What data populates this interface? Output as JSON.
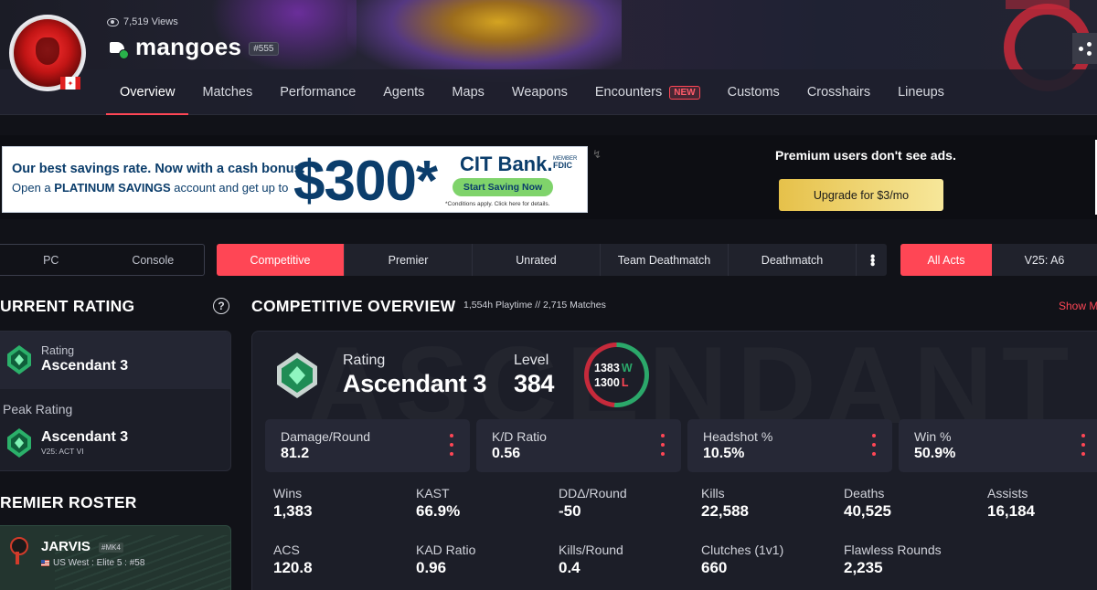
{
  "profile": {
    "views": "7,519 Views",
    "name": "mangoes",
    "tag": "#555"
  },
  "nav": {
    "tabs": [
      {
        "label": "Overview"
      },
      {
        "label": "Matches"
      },
      {
        "label": "Performance"
      },
      {
        "label": "Agents"
      },
      {
        "label": "Maps"
      },
      {
        "label": "Weapons"
      },
      {
        "label": "Encounters",
        "badge": "NEW"
      },
      {
        "label": "Customs"
      },
      {
        "label": "Crosshairs"
      },
      {
        "label": "Lineups"
      }
    ]
  },
  "ad": {
    "line1": "Our best savings rate. Now with a cash bonus.",
    "line2_pre": "Open a",
    "line2_bold": "PLATINUM SAVINGS",
    "line2_post": "account and get up to",
    "amount": "$300*",
    "brand": "CIT Bank.",
    "member": "MEMBER",
    "fdic": "FDIC",
    "cta": "Start Saving Now",
    "fine": "*Conditions apply. Click here for details."
  },
  "premium": {
    "text": "Premium users don't see ads.",
    "button": "Upgrade for $3/mo"
  },
  "filters": {
    "platforms": [
      "PC",
      "Console"
    ],
    "modes": [
      "Competitive",
      "Premier",
      "Unrated",
      "Team Deathmatch",
      "Deathmatch"
    ],
    "acts": [
      "All Acts",
      "V25: A6"
    ]
  },
  "current_rating": {
    "title": "URRENT RATING",
    "help": "?",
    "rating_label": "Rating",
    "rating_value": "Ascendant 3",
    "peak_label": "Peak Rating",
    "peak_value": "Ascendant 3",
    "peak_act": "V25: ACT VI"
  },
  "roster": {
    "title": "REMIER ROSTER",
    "team": "JARVIS",
    "tag": "#MK4",
    "region": "US West : Elite 5 : #58"
  },
  "overview": {
    "title": "COMPETITIVE OVERVIEW",
    "playtime": "1,554h Playtime",
    "separator": "//",
    "matches": "2,715 Matches",
    "show_more": "Show M",
    "watermark": "ASCENDANT",
    "rating_label": "Rating",
    "rating_value": "Ascendant 3",
    "level_label": "Level",
    "level_value": "384",
    "wins_count": "1383",
    "wins_letter": "W",
    "losses_count": "1300",
    "losses_letter": "L",
    "cards": [
      {
        "label": "Damage/Round",
        "value": "81.2"
      },
      {
        "label": "K/D Ratio",
        "value": "0.56"
      },
      {
        "label": "Headshot %",
        "value": "10.5%"
      },
      {
        "label": "Win %",
        "value": "50.9%"
      }
    ],
    "stats": [
      {
        "label": "Wins",
        "value": "1,383"
      },
      {
        "label": "KAST",
        "value": "66.9%"
      },
      {
        "label": "DDΔ/Round",
        "value": "-50"
      },
      {
        "label": "Kills",
        "value": "22,588"
      },
      {
        "label": "Deaths",
        "value": "40,525"
      },
      {
        "label": "Assists",
        "value": "16,184"
      },
      {
        "label": "ACS",
        "value": "120.8"
      },
      {
        "label": "KAD Ratio",
        "value": "0.96"
      },
      {
        "label": "Kills/Round",
        "value": "0.4"
      },
      {
        "label": "Clutches (1v1)",
        "value": "660"
      },
      {
        "label": "Flawless Rounds",
        "value": "2,235"
      }
    ]
  },
  "colors": {
    "accent": "#ff4655",
    "win": "#2ba86a",
    "loss": "#c62a3b",
    "panel": "#1c1e28"
  }
}
